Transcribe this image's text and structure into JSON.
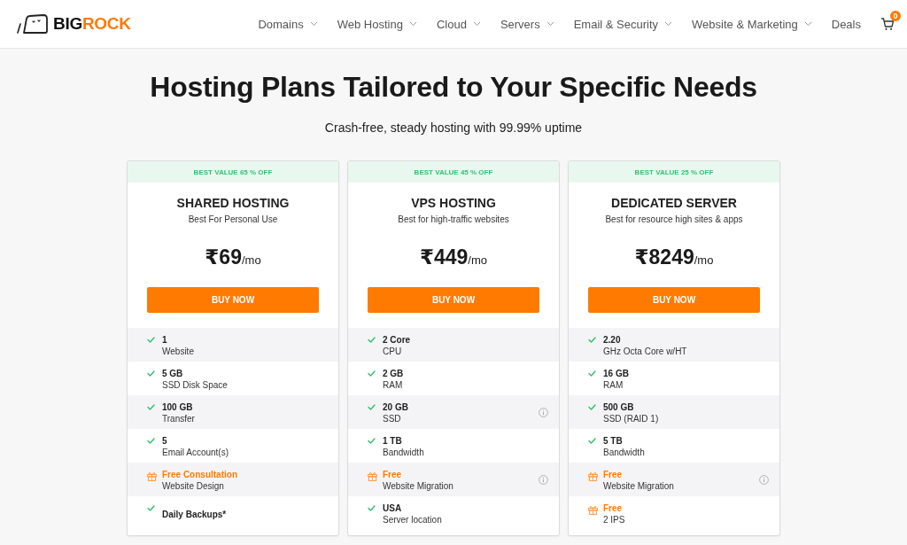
{
  "header": {
    "logo": {
      "primary": "BIG",
      "accent": "ROCK"
    },
    "nav": [
      {
        "label": "Domains",
        "has_menu": true
      },
      {
        "label": "Web Hosting",
        "has_menu": true
      },
      {
        "label": "Cloud",
        "has_menu": true
      },
      {
        "label": "Servers",
        "has_menu": true
      },
      {
        "label": "Email & Security",
        "has_menu": true
      },
      {
        "label": "Website & Marketing",
        "has_menu": true
      },
      {
        "label": "Deals",
        "has_menu": false
      }
    ],
    "cart": {
      "count": "0"
    }
  },
  "hero": {
    "title": "Hosting Plans Tailored to Your Specific Needs",
    "subtitle": "Crash-free, steady hosting with 99.99% uptime"
  },
  "plans": [
    {
      "badge": "BEST VALUE 65 % OFF",
      "name": "SHARED HOSTING",
      "tagline": "Best For Personal Use",
      "price": "₹69",
      "period": "/mo",
      "button": "BUY NOW",
      "features": [
        {
          "kind": "check",
          "title": "1",
          "detail": "Website",
          "info": false
        },
        {
          "kind": "check",
          "title": "5 GB",
          "detail": "SSD Disk Space",
          "info": false
        },
        {
          "kind": "check",
          "title": "100 GB",
          "detail": "Transfer",
          "info": false
        },
        {
          "kind": "check",
          "title": "5",
          "detail": "Email Account(s)",
          "info": false
        },
        {
          "kind": "gift",
          "title": "Free Consultation",
          "detail": "Website Design",
          "info": false
        },
        {
          "kind": "check",
          "title": "Daily Backups*",
          "info": false
        }
      ]
    },
    {
      "badge": "BEST VALUE 45 % OFF",
      "name": "VPS HOSTING",
      "tagline": "Best for high-traffic websites",
      "price": "₹449",
      "period": "/mo",
      "button": "BUY NOW",
      "features": [
        {
          "kind": "check",
          "title": "2 Core",
          "detail": "CPU",
          "info": false
        },
        {
          "kind": "check",
          "title": "2 GB",
          "detail": "RAM",
          "info": false
        },
        {
          "kind": "check",
          "title": "20 GB",
          "detail": "SSD",
          "info": true
        },
        {
          "kind": "check",
          "title": "1 TB",
          "detail": "Bandwidth",
          "info": false
        },
        {
          "kind": "gift",
          "title": "Free",
          "detail": "Website Migration",
          "info": true
        },
        {
          "kind": "check",
          "title": "USA",
          "detail": "Server location",
          "info": false
        }
      ]
    },
    {
      "badge": "BEST VALUE 25 % OFF",
      "name": "DEDICATED SERVER",
      "tagline": "Best for resource high sites & apps",
      "price": "₹8249",
      "period": "/mo",
      "button": "BUY NOW",
      "features": [
        {
          "kind": "check",
          "title": "2.20",
          "detail": "GHz Octa Core w/HT",
          "info": false
        },
        {
          "kind": "check",
          "title": "16 GB",
          "detail": "RAM",
          "info": false
        },
        {
          "kind": "check",
          "title": "500 GB",
          "detail": "SSD (RAID 1)",
          "info": false
        },
        {
          "kind": "check",
          "title": "5 TB",
          "detail": "Bandwidth",
          "info": false
        },
        {
          "kind": "gift",
          "title": "Free",
          "detail": "Website Migration",
          "info": true
        },
        {
          "kind": "gift",
          "title": "Free",
          "detail": "2 IPS",
          "info": false
        }
      ]
    }
  ]
}
